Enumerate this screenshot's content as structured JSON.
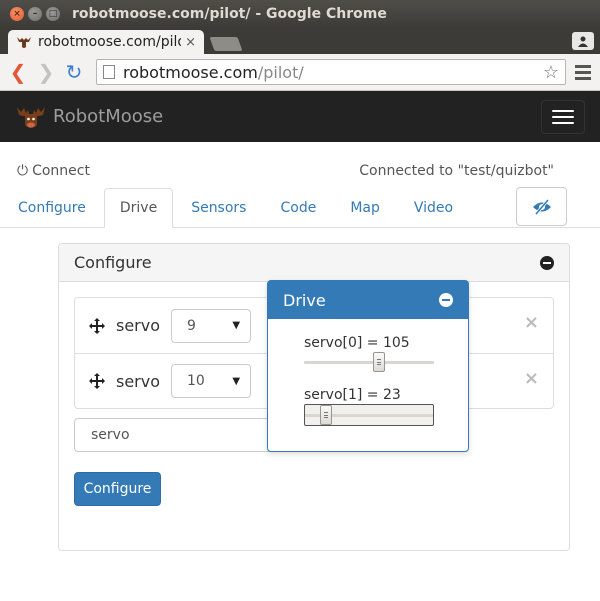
{
  "window": {
    "title": "robotmoose.com/pilot/ - Google Chrome",
    "close_glyph": "×",
    "min_glyph": "–",
    "max_glyph": "□"
  },
  "browser": {
    "tab_title": "robotmoose.com/pilot/",
    "tab_close": "×",
    "url_host": "robotmoose.com",
    "url_path": "/pilot/",
    "star_glyph": "☆",
    "back_glyph": "❮",
    "forward_glyph": "❯",
    "reload_glyph": "↻"
  },
  "navbar": {
    "brand": "RobotMoose"
  },
  "subheader": {
    "power_glyph": "⏻",
    "connect_label": "Connect",
    "status": "Connected to \"test/quizbot\""
  },
  "tabs": [
    {
      "label": "Configure"
    },
    {
      "label": "Drive"
    },
    {
      "label": "Sensors"
    },
    {
      "label": "Code"
    },
    {
      "label": "Map"
    },
    {
      "label": "Video"
    }
  ],
  "active_tab": "Drive",
  "configure_panel": {
    "title": "Configure",
    "rows": [
      {
        "label": "servo",
        "value": "9"
      },
      {
        "label": "servo",
        "value": "10"
      }
    ],
    "remove_glyph": "×",
    "caret_glyph": "▼",
    "input_value": "servo",
    "button_label": "Configure"
  },
  "drive_panel": {
    "title": "Drive",
    "sliders": [
      {
        "label": "servo[0] = 105",
        "value": 105,
        "max": 180
      },
      {
        "label": "servo[1] = 23",
        "value": 23,
        "max": 180
      }
    ]
  },
  "colors": {
    "primary": "#337ab7",
    "navbar": "#222222",
    "link": "#337ab7"
  }
}
